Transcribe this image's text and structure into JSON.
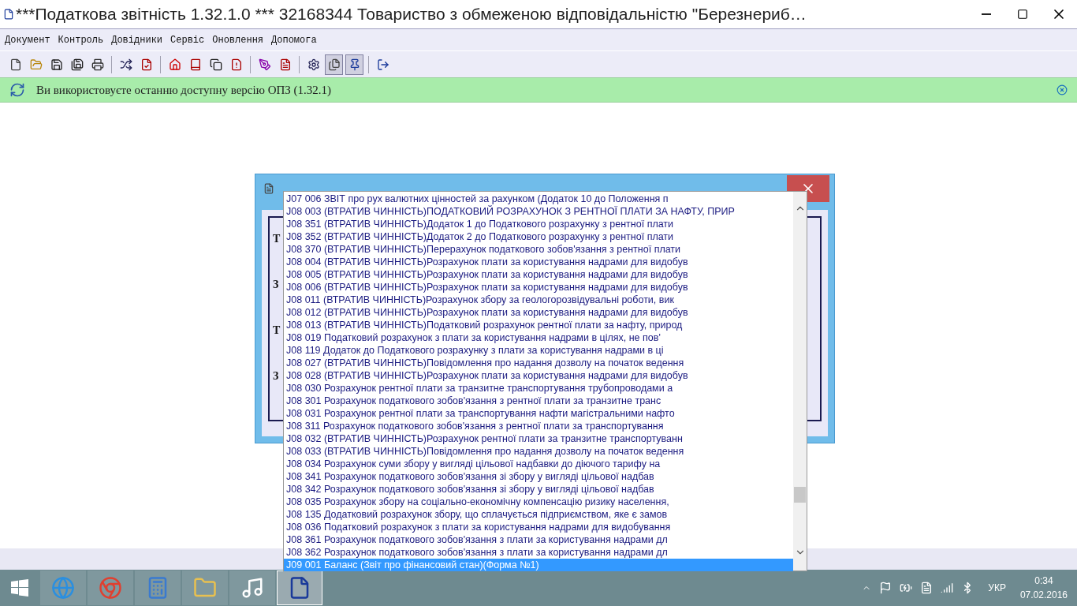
{
  "window": {
    "title": "***Податкова звітність 1.32.1.0 *** 32168344 Товариство з обмеженою відповідальністю \"Березнериб…"
  },
  "menu": [
    "Документ",
    "Контроль",
    "Довідники",
    "Сервіс",
    "Оновлення",
    "Допомога"
  ],
  "toolbar": [
    {
      "kind": "new",
      "pressed": false
    },
    {
      "kind": "open",
      "pressed": false
    },
    {
      "kind": "save",
      "pressed": false
    },
    {
      "kind": "save-as",
      "pressed": false
    },
    {
      "kind": "print",
      "pressed": false
    },
    {
      "kind": "sep"
    },
    {
      "kind": "tools",
      "pressed": false
    },
    {
      "kind": "check",
      "pressed": false
    },
    {
      "kind": "sep"
    },
    {
      "kind": "home",
      "pressed": false
    },
    {
      "kind": "book",
      "pressed": false
    },
    {
      "kind": "copy",
      "pressed": false
    },
    {
      "kind": "warning",
      "pressed": false
    },
    {
      "kind": "sep"
    },
    {
      "kind": "pen",
      "pressed": false
    },
    {
      "kind": "doc",
      "pressed": false
    },
    {
      "kind": "sep"
    },
    {
      "kind": "settings",
      "pressed": false
    },
    {
      "kind": "stack",
      "pressed": true
    },
    {
      "kind": "pin",
      "pressed": true
    },
    {
      "kind": "sep"
    },
    {
      "kind": "exit",
      "pressed": false
    }
  ],
  "notice": {
    "text": "Ви використовуєте останню доступну версію ОПЗ (1.32.1)"
  },
  "dialog": {
    "labels": [
      "Т",
      "З",
      "Т",
      "З"
    ]
  },
  "dropdown": {
    "items": [
      {
        "text": "J07 006 ЗВІТ про рух валютних цінностей за рахунком (Додаток 10 до Положення п",
        "selected": false
      },
      {
        "text": "J08 003 (ВТРАТИВ ЧИННІСТЬ)ПОДАТКОВИЙ РОЗРАХУНОК З РЕНТНОЇ ПЛАТИ ЗА НАФТУ, ПРИР",
        "selected": false
      },
      {
        "text": "J08 351 (ВТРАТИВ ЧИННІСТЬ)Додаток 1 до Податкового розрахунку з рентної плати",
        "selected": false
      },
      {
        "text": "J08 352 (ВТРАТИВ ЧИННІСТЬ)Додаток 2 до Податкового розрахунку з рентної плати",
        "selected": false
      },
      {
        "text": "J08 370 (ВТРАТИВ ЧИННІСТЬ)Перерахунок податкового зобов'язання з рентної плати",
        "selected": false
      },
      {
        "text": "J08 004 (ВТРАТИВ ЧИННІСТЬ)Розрахунок плати за користування надрами для видобув",
        "selected": false
      },
      {
        "text": "J08 005 (ВТРАТИВ ЧИННІСТЬ)Розрахунок плати за користування надрами для видобув",
        "selected": false
      },
      {
        "text": "J08 006 (ВТРАТИВ ЧИННІСТЬ)Розрахунок плати за користування надрами для видобув",
        "selected": false
      },
      {
        "text": "J08 011 (ВТРАТИВ ЧИННІСТЬ)Розрахунок збору за геологорозвідувальні роботи, вик",
        "selected": false
      },
      {
        "text": "J08 012 (ВТРАТИВ ЧИННІСТЬ)Розрахунок плати за користування надрами для видобув",
        "selected": false
      },
      {
        "text": "J08 013 (ВТРАТИВ ЧИННІСТЬ)Податковий розрахунок рентної плати за нафту, природ",
        "selected": false
      },
      {
        "text": "J08 019 Податковий розрахунок з плати за користування надрами в цілях, не пов'",
        "selected": false
      },
      {
        "text": "J08 119 Додаток до Податкового розрахунку з плати за користування надрами в ці",
        "selected": false
      },
      {
        "text": "J08 027 (ВТРАТИВ ЧИННІСТЬ)Повідомлення про надання дозволу на початок ведення",
        "selected": false
      },
      {
        "text": "J08 028 (ВТРАТИВ ЧИННІСТЬ)Розрахунок плати за користування надрами для видобув",
        "selected": false
      },
      {
        "text": "J08 030 Розрахунок рентної плати за транзитне транспортування трубопроводами а",
        "selected": false
      },
      {
        "text": "J08 301 Розрахунок податкового зобов'язання з рентної плати за транзитне транс",
        "selected": false
      },
      {
        "text": "J08 031 Розрахунок рентної плати за транспортування нафти магістральними нафто",
        "selected": false
      },
      {
        "text": "J08 311 Розрахунок податкового зобов'язання з рентної плати за транспортування",
        "selected": false
      },
      {
        "text": "J08 032 (ВТРАТИВ ЧИННІСТЬ)Розрахунок рентної плати за транзитне транспортуванн",
        "selected": false
      },
      {
        "text": "J08 033 (ВТРАТИВ ЧИННІСТЬ)Повідомлення про надання дозволу на початок ведення",
        "selected": false
      },
      {
        "text": "J08 034 Розрахунок суми збору у вигляді цільової надбавки до діючого тарифу на",
        "selected": false
      },
      {
        "text": "J08 341 Розрахунок податкового зобов'язання зі збору у вигляді цільової надбав",
        "selected": false
      },
      {
        "text": "J08 342 Розрахунок податкового зобов'язання зі збору у вигляді цільової надбав",
        "selected": false
      },
      {
        "text": "J08 035 Розрахунок збору на соціально-економічну компенсацію ризику населення,",
        "selected": false
      },
      {
        "text": "J08 135 Додатковий розрахунок збору, що сплачується підприємством, яке є замов",
        "selected": false
      },
      {
        "text": "J08 036 Податковий розрахунок з плати за користування надрами для видобування",
        "selected": false
      },
      {
        "text": "J08 361 Розрахунок податкового зобов'язання з плати за користування надрами дл",
        "selected": false
      },
      {
        "text": "J08 362 Розрахунок податкового зобов'язання з плати за користування надрами дл",
        "selected": false
      },
      {
        "text": "J09 001 Баланс (Звіт про фінансовий стан)(Форма №1)",
        "selected": true
      }
    ]
  },
  "taskbar": {
    "apps": [
      {
        "kind": "ie",
        "selected": false
      },
      {
        "kind": "chrome",
        "selected": false
      },
      {
        "kind": "calculator",
        "selected": false
      },
      {
        "kind": "explorer",
        "selected": false
      },
      {
        "kind": "music",
        "selected": false
      },
      {
        "kind": "app",
        "selected": true
      }
    ],
    "language": "УКР",
    "time": "0:34",
    "date": "07.02.2016"
  }
}
